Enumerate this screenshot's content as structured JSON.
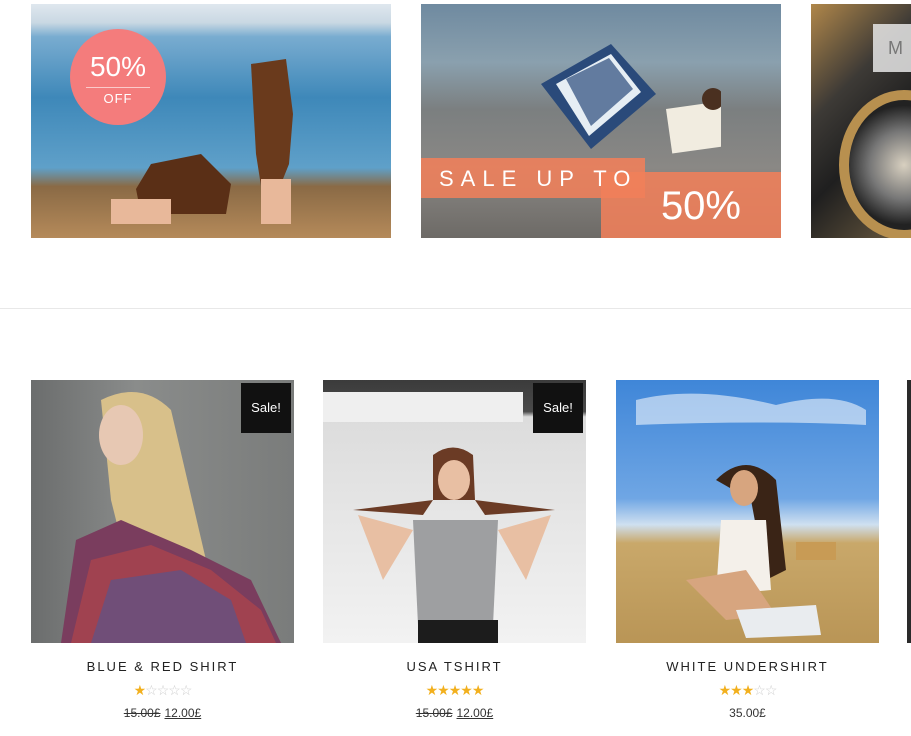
{
  "banners": [
    {
      "badge_big": "50%",
      "badge_small": "OFF",
      "colors": {
        "badge": "#f47c7c"
      }
    },
    {
      "strip_text": "SALE UP TO",
      "strip_pct": "50%",
      "colors": {
        "strip": "#f0805a"
      }
    },
    {
      "tag": "M"
    }
  ],
  "products": [
    {
      "title": "BLUE & RED SHIRT",
      "sale_badge": "Sale!",
      "rating": 1,
      "rating_max": 5,
      "old_price": "15.00£",
      "price": "12.00£"
    },
    {
      "title": "USA TSHIRT",
      "sale_badge": "Sale!",
      "rating": 5,
      "rating_max": 5,
      "old_price": "15.00£",
      "price": "12.00£"
    },
    {
      "title": "WHITE UNDERSHIRT",
      "rating": 3,
      "rating_max": 5,
      "price": "35.00£"
    }
  ],
  "icons": {
    "star_filled": "star-icon",
    "star_empty": "star-outline-icon"
  },
  "colors": {
    "star": "#f2b01e",
    "sale_badge_bg": "#111111",
    "divider": "#e8e8e8"
  }
}
